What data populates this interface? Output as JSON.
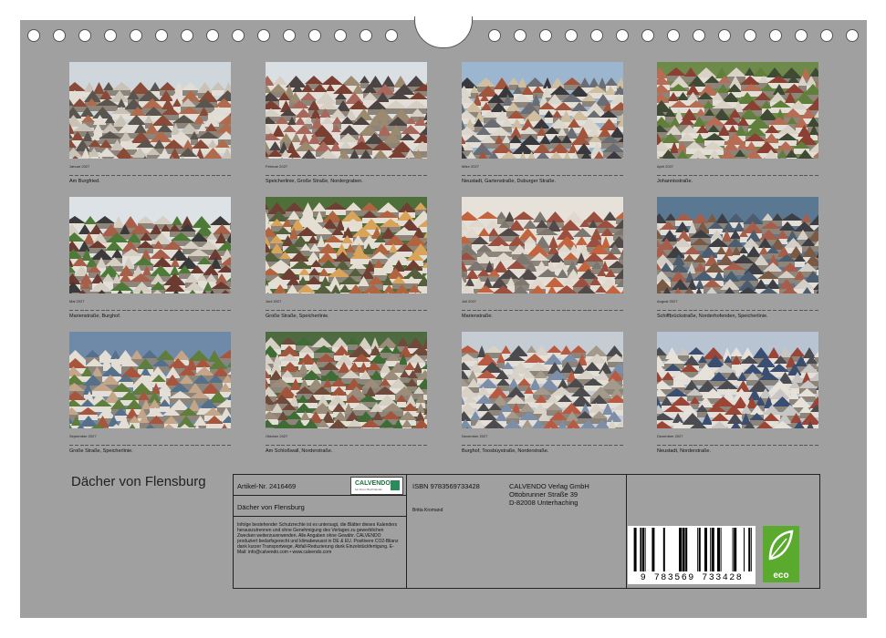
{
  "document": {
    "title": "Dächer von Flensburg"
  },
  "months": [
    {
      "name": "Januar 2027",
      "caption": "Am Burgfried."
    },
    {
      "name": "Februar 2027",
      "caption": "Speicherlinie, Große Straße, Nordergraben."
    },
    {
      "name": "März 2027",
      "caption": "Neustadt, Gartenstraße, Duburger Straße."
    },
    {
      "name": "April 2027",
      "caption": "Johannisstraße."
    },
    {
      "name": "Mai 2027",
      "caption": "Marienstraße, Burghof."
    },
    {
      "name": "Juni 2027",
      "caption": "Große Straße, Speicherlinie."
    },
    {
      "name": "Juli 2027",
      "caption": "Marienstraße."
    },
    {
      "name": "August 2027",
      "caption": "Schiffbrückstraße, Norderhofenden, Speicherlinie."
    },
    {
      "name": "September 2027",
      "caption": "Große Straße, Speicherlinie."
    },
    {
      "name": "Oktober 2027",
      "caption": "Am Schloßwall, Norderstraße."
    },
    {
      "name": "November 2027",
      "caption": "Burghof, Toosbüystraße, Norderstraße."
    },
    {
      "name": "Dezember 2027",
      "caption": "Neustadt, Norderstraße."
    }
  ],
  "info": {
    "article": "Artikel-Nr. 2416469",
    "logo_text": "CALVENDO",
    "logo_sub": "bei Ihrem Buchhändler",
    "product_title": "Dächer von Flensburg",
    "legal": "Infolge bestehender Schutzrechte ist es untersagt, die Blätter dieses Kalenders herauszutrennen und ohne Genehmigung des Verlages zu gewerblichen Zwecken weiterzuverwenden. Alle Angaben ohne Gewähr. CALVENDO produziert bedarfsgerecht und klimabewusst in DE & EU. Positivere CO2-Bilanz dank kurzer Transportwege, Abfall-Reduzierung dank Einzelstückfertigung. E-Mail: info@calvendo.com • www.calvendo.com",
    "isbn": "ISBN 9783569733428",
    "author": "Britta Kromand",
    "publisher_name": "CALVENDO Verlag GmbH",
    "publisher_street": "Ottobrunner Straße 39",
    "publisher_city": "D-82008 Unterhaching",
    "barcode_number": "9 783569 733428",
    "eco_label": "eco"
  }
}
